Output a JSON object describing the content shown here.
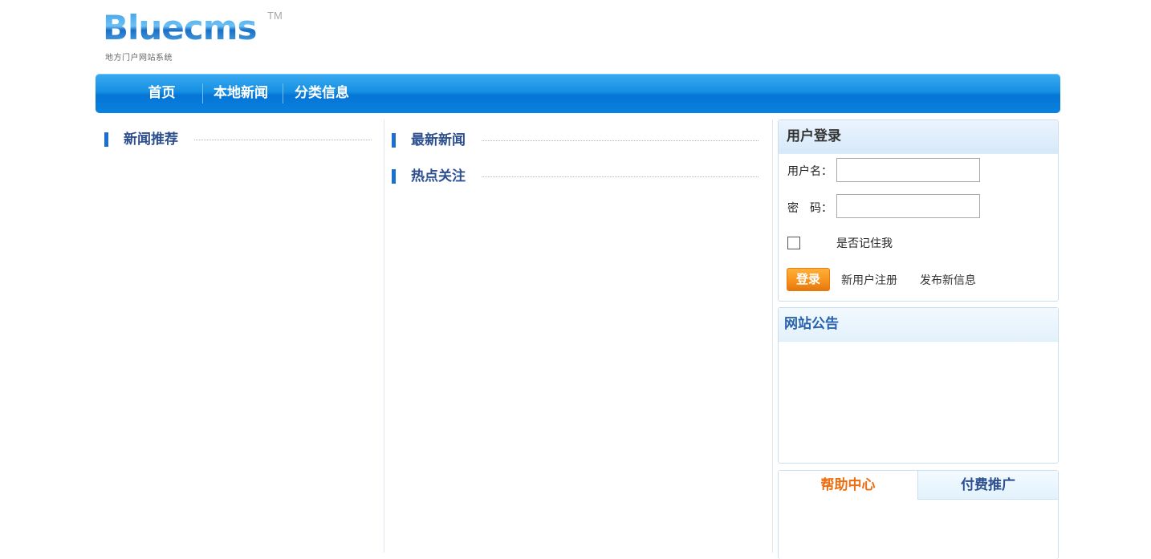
{
  "logo": {
    "text": "Bluecms",
    "tm": "TM",
    "subtitle": "地方门户网站系统"
  },
  "nav": {
    "items": [
      {
        "label": "首页"
      },
      {
        "label": "本地新闻"
      },
      {
        "label": "分类信息"
      }
    ]
  },
  "sections": {
    "news_recommend": "新闻推荐",
    "latest_news": "最新新闻",
    "hot_focus": "热点关注"
  },
  "login": {
    "title": "用户登录",
    "username_label": "用户名：",
    "password_label": "密　码：",
    "username_value": "",
    "password_value": "",
    "remember_label": "是否记住我",
    "login_button": "登录",
    "register_link": "新用户注册",
    "post_link": "发布新信息"
  },
  "notice": {
    "title": "网站公告"
  },
  "tabs": [
    {
      "label": "帮助中心",
      "active": true
    },
    {
      "label": "付费推广",
      "active": false
    }
  ],
  "colors": {
    "nav_blue": "#0a82de",
    "heading_blue": "#2d4f8f",
    "accent_orange": "#f06d0f",
    "button_orange": "#f6901a"
  }
}
